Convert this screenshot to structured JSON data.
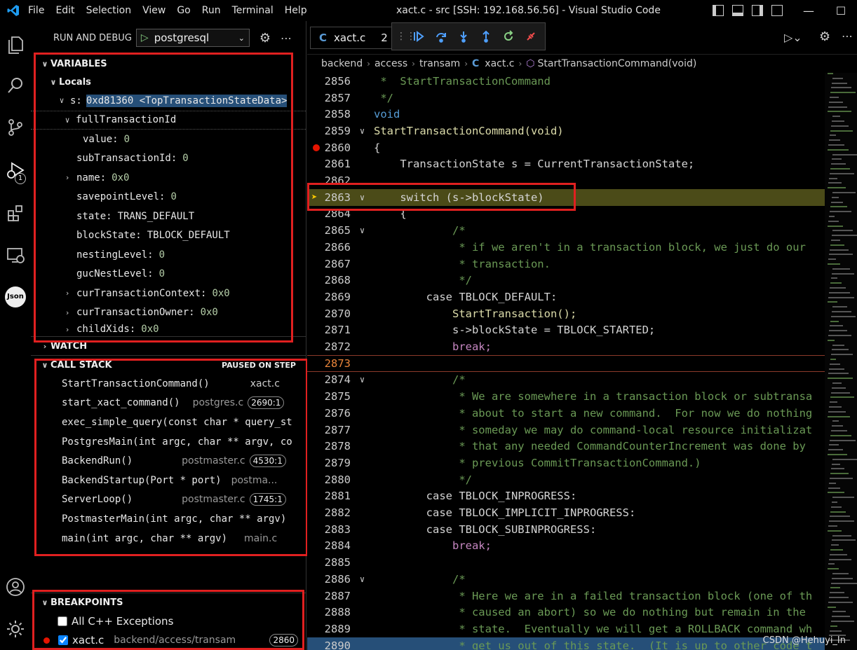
{
  "titlebar": {
    "menus": [
      "File",
      "Edit",
      "Selection",
      "View",
      "Go",
      "Run",
      "Terminal",
      "Help"
    ],
    "title": "xact.c - src [SSH: 192.168.56.56] - Visual Studio Code"
  },
  "activity": {
    "debug_badge": "1",
    "json_label": "Json"
  },
  "sidebar": {
    "header": "RUN AND DEBUG",
    "config": "postgresql",
    "variables": {
      "title": "VARIABLES",
      "locals": "Locals",
      "s_name": "s:",
      "s_value": "0xd81360 <TopTransactionStateData>",
      "rows": [
        {
          "name": "fullTransactionId",
          "value": ""
        },
        {
          "name": "value:",
          "value": "0"
        },
        {
          "name": "subTransactionId:",
          "value": "0"
        },
        {
          "name": "name:",
          "value": "0x0"
        },
        {
          "name": "savepointLevel:",
          "value": "0"
        },
        {
          "name": "state:",
          "value": "TRANS_DEFAULT"
        },
        {
          "name": "blockState:",
          "value": "TBLOCK_DEFAULT"
        },
        {
          "name": "nestingLevel:",
          "value": "0"
        },
        {
          "name": "gucNestLevel:",
          "value": "0"
        },
        {
          "name": "curTransactionContext:",
          "value": "0x0"
        },
        {
          "name": "curTransactionOwner:",
          "value": "0x0"
        },
        {
          "name": "childXids:",
          "value": "0x0"
        }
      ]
    },
    "watch": {
      "title": "WATCH"
    },
    "callstack": {
      "title": "CALL STACK",
      "status": "PAUSED ON STEP",
      "frames": [
        {
          "fn": "StartTransactionCommand()",
          "file": "xact.c",
          "line": ""
        },
        {
          "fn": "start_xact_command()",
          "file": "postgres.c",
          "line": "2690:1"
        },
        {
          "fn": "exec_simple_query(const char * query_st",
          "file": "",
          "line": ""
        },
        {
          "fn": "PostgresMain(int argc, char ** argv, co",
          "file": "",
          "line": ""
        },
        {
          "fn": "BackendRun()",
          "file": "postmaster.c",
          "line": "4530:1"
        },
        {
          "fn": "BackendStartup(Port * port)",
          "file": "postma...",
          "line": ""
        },
        {
          "fn": "ServerLoop()",
          "file": "postmaster.c",
          "line": "1745:1"
        },
        {
          "fn": "PostmasterMain(int argc, char ** argv)",
          "file": "",
          "line": ""
        },
        {
          "fn": "main(int argc, char ** argv)",
          "file": "main.c",
          "line": ""
        }
      ]
    },
    "breakpoints": {
      "title": "BREAKPOINTS",
      "items": [
        {
          "label": "All C++ Exceptions",
          "path": "",
          "line": ""
        },
        {
          "label": "xact.c",
          "path": "backend/access/transam",
          "line": "2860"
        }
      ]
    }
  },
  "editor": {
    "tab": "xact.c",
    "tab_extra": "2",
    "breadcrumbs": [
      "backend",
      "access",
      "transam",
      "xact.c",
      "StartTransactionCommand(void)"
    ],
    "watermark": "CSDN @Hehuyi_In",
    "lines": [
      {
        "n": "2856",
        "fold": "",
        "t": " *  StartTransactionCommand",
        "cls": "c-comment"
      },
      {
        "n": "2857",
        "fold": "",
        "t": " */",
        "cls": "c-comment"
      },
      {
        "n": "2858",
        "fold": "",
        "t": "void",
        "cls": "c-type"
      },
      {
        "n": "2859",
        "fold": "v",
        "t": "StartTransactionCommand(void)",
        "cls": "c-fn"
      },
      {
        "n": "2860",
        "fold": "",
        "t": "{",
        "cls": "c-plain"
      },
      {
        "n": "2861",
        "fold": "",
        "t": "    TransactionState s = CurrentTransactionState;",
        "cls": "c-plain"
      },
      {
        "n": "2862",
        "fold": "",
        "t": "",
        "cls": "c-plain"
      },
      {
        "n": "2863",
        "fold": "v",
        "t": "    switch (s->blockState)",
        "cls": "c-plain"
      },
      {
        "n": "2864",
        "fold": "",
        "t": "    {",
        "cls": "c-plain"
      },
      {
        "n": "2865",
        "fold": "v",
        "t": "            /*",
        "cls": "c-comment"
      },
      {
        "n": "2866",
        "fold": "",
        "t": "             * if we aren't in a transaction block, we just do our",
        "cls": "c-comment"
      },
      {
        "n": "2867",
        "fold": "",
        "t": "             * transaction.",
        "cls": "c-comment"
      },
      {
        "n": "2868",
        "fold": "",
        "t": "             */",
        "cls": "c-comment"
      },
      {
        "n": "2869",
        "fold": "",
        "t": "        case TBLOCK_DEFAULT:",
        "cls": "c-plain"
      },
      {
        "n": "2870",
        "fold": "",
        "t": "            StartTransaction();",
        "cls": "c-fn"
      },
      {
        "n": "2871",
        "fold": "",
        "t": "            s->blockState = TBLOCK_STARTED;",
        "cls": "c-plain"
      },
      {
        "n": "2872",
        "fold": "",
        "t": "            break;",
        "cls": "c-kw"
      },
      {
        "n": "2873",
        "fold": "",
        "t": "",
        "cls": "c-plain"
      },
      {
        "n": "2874",
        "fold": "v",
        "t": "            /*",
        "cls": "c-comment"
      },
      {
        "n": "2875",
        "fold": "",
        "t": "             * We are somewhere in a transaction block or subtransa",
        "cls": "c-comment"
      },
      {
        "n": "2876",
        "fold": "",
        "t": "             * about to start a new command.  For now we do nothing",
        "cls": "c-comment"
      },
      {
        "n": "2877",
        "fold": "",
        "t": "             * someday we may do command-local resource initializat",
        "cls": "c-comment"
      },
      {
        "n": "2878",
        "fold": "",
        "t": "             * that any needed CommandCounterIncrement was done by",
        "cls": "c-comment"
      },
      {
        "n": "2879",
        "fold": "",
        "t": "             * previous CommitTransactionCommand.)",
        "cls": "c-comment"
      },
      {
        "n": "2880",
        "fold": "",
        "t": "             */",
        "cls": "c-comment"
      },
      {
        "n": "2881",
        "fold": "",
        "t": "        case TBLOCK_INPROGRESS:",
        "cls": "c-plain"
      },
      {
        "n": "2882",
        "fold": "",
        "t": "        case TBLOCK_IMPLICIT_INPROGRESS:",
        "cls": "c-plain"
      },
      {
        "n": "2883",
        "fold": "",
        "t": "        case TBLOCK_SUBINPROGRESS:",
        "cls": "c-plain"
      },
      {
        "n": "2884",
        "fold": "",
        "t": "            break;",
        "cls": "c-kw"
      },
      {
        "n": "2885",
        "fold": "",
        "t": "",
        "cls": "c-plain"
      },
      {
        "n": "2886",
        "fold": "v",
        "t": "            /*",
        "cls": "c-comment"
      },
      {
        "n": "2887",
        "fold": "",
        "t": "             * Here we are in a failed transaction block (one of th",
        "cls": "c-comment"
      },
      {
        "n": "2888",
        "fold": "",
        "t": "             * caused an abort) so we do nothing but remain in the",
        "cls": "c-comment"
      },
      {
        "n": "2889",
        "fold": "",
        "t": "             * state.  Eventually we will get a ROLLBACK command wh",
        "cls": "c-comment"
      },
      {
        "n": "2890",
        "fold": "",
        "t": "             * get us out of this state.  (It is up to other code t",
        "cls": "c-comment"
      }
    ]
  }
}
